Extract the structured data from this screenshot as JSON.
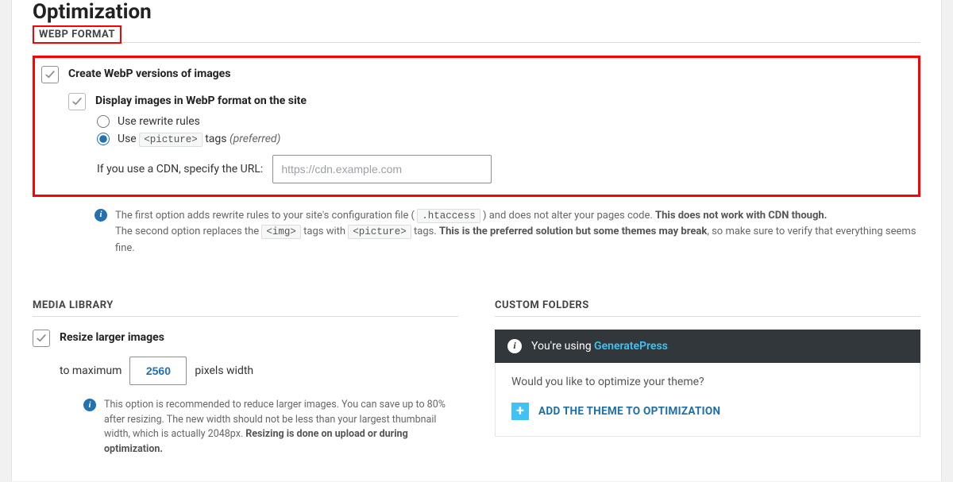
{
  "page": {
    "title": "Optimization"
  },
  "webp": {
    "section_label": "WEBP FORMAT",
    "create_label": "Create WebP versions of images",
    "display_label": "Display images in WebP format on the site",
    "radio_rewrite": "Use rewrite rules",
    "radio_picture_prefix": "Use ",
    "radio_picture_code": "<picture>",
    "radio_picture_suffix": " tags ",
    "radio_picture_preferred": "(preferred)",
    "cdn_label": "If you use a CDN, specify the URL:",
    "cdn_placeholder": "https://cdn.example.com",
    "info_line1_a": "The first option adds rewrite rules to your site's configuration file ( ",
    "info_code1": ".htaccess",
    "info_line1_b": " ) and does not alter your pages code. ",
    "info_line1_bold": "This does not work with CDN though.",
    "info_line2_a": "The second option replaces the ",
    "info_code2": "<img>",
    "info_line2_b": " tags with ",
    "info_code3": "<picture>",
    "info_line2_c": " tags. ",
    "info_line2_bold": "This is the preferred solution but some themes may break",
    "info_line2_d": ", so make sure to verify that everything seems fine."
  },
  "media": {
    "section_label": "MEDIA LIBRARY",
    "resize_label": "Resize larger images",
    "to_max": "to maximum",
    "px_width": "pixels width",
    "value": "2560",
    "info_a": "This option is recommended to reduce larger images. You can save up to 80% after resizing. The new width should not be less than your largest thumbnail width, which is actually 2048px. ",
    "info_bold": "Resizing is done on upload or during optimization."
  },
  "custom": {
    "section_label": "CUSTOM FOLDERS",
    "banner_prefix": "You're using ",
    "theme_name": "GeneratePress",
    "question": "Would you like to optimize your theme?",
    "add_btn": "ADD THE THEME TO OPTIMIZATION"
  }
}
